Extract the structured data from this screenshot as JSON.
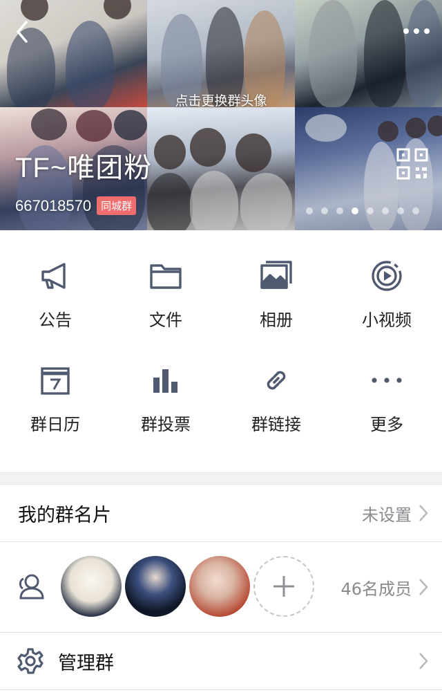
{
  "header": {
    "change_avatar_text": "点击更换群头像",
    "group_name": "TF~唯团粉",
    "group_id": "667018570",
    "city_badge": "同城群",
    "page_dots_count": 8,
    "active_dot_index": 3
  },
  "features": [
    {
      "label": "公告",
      "icon": "megaphone-icon"
    },
    {
      "label": "文件",
      "icon": "folder-icon"
    },
    {
      "label": "相册",
      "icon": "album-icon"
    },
    {
      "label": "小视频",
      "icon": "video-icon"
    },
    {
      "label": "群日历",
      "icon": "calendar-icon"
    },
    {
      "label": "群投票",
      "icon": "bar-chart-icon"
    },
    {
      "label": "群链接",
      "icon": "link-icon"
    },
    {
      "label": "更多",
      "icon": "more-dots-icon"
    }
  ],
  "card": {
    "title": "我的群名片",
    "value": "未设置"
  },
  "members": {
    "count_text": "46名成员"
  },
  "manage": {
    "title": "管理群"
  },
  "colors": {
    "icon": "#4f5a70",
    "badge": "#f06d6d",
    "secondary_text": "#8a8a8f"
  }
}
